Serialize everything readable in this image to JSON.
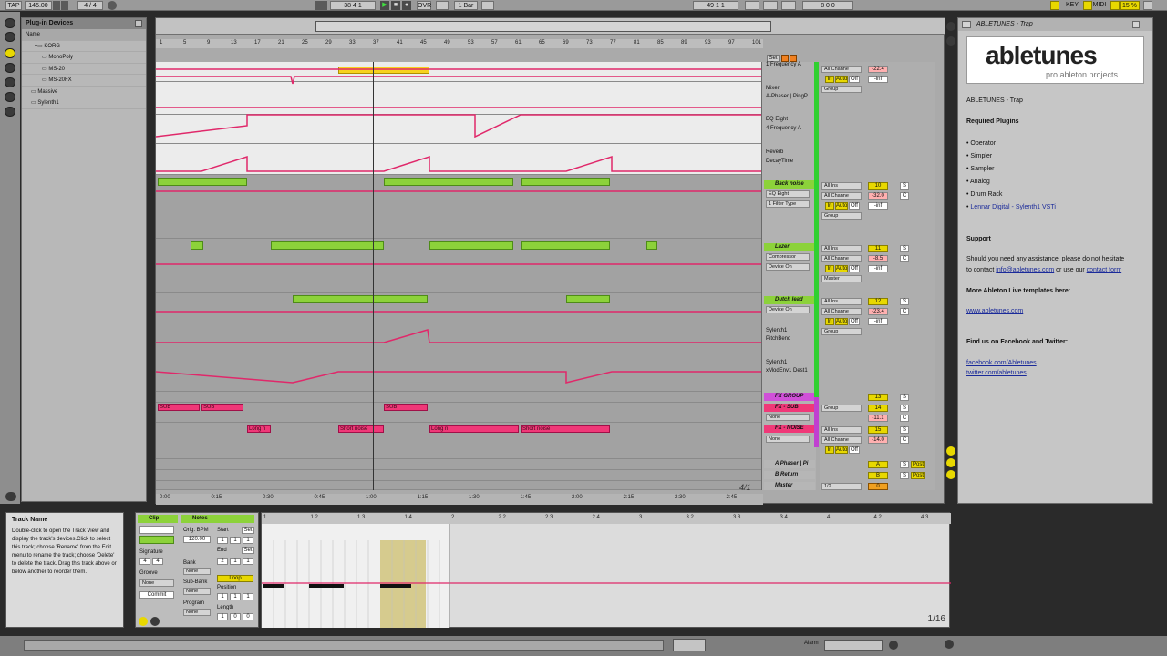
{
  "transport": {
    "tap": "TAP",
    "bpm": "145.00",
    "time_sig": "4 / 4",
    "position": "38   4   1",
    "ovr": "OVR",
    "quantize": "1 Bar",
    "loop_start": "49   1   1",
    "loop_length": "8   0   0",
    "key": "KEY",
    "midi": "MIDI",
    "cpu": "15 %"
  },
  "browser": {
    "header": "Plug-in Devices",
    "col_name": "Name",
    "items": [
      "KORG",
      "MonoPoly",
      "MS-20",
      "MS-20FX",
      "Massive",
      "Sylenth1"
    ]
  },
  "ruler": {
    "bars": [
      "1",
      "5",
      "9",
      "13",
      "17",
      "21",
      "25",
      "29",
      "33",
      "37",
      "41",
      "45",
      "49",
      "53",
      "57",
      "61",
      "65",
      "69",
      "73",
      "77",
      "81",
      "85",
      "89",
      "93",
      "97",
      "101"
    ],
    "set_label": "Set",
    "times": [
      "0:00",
      "0:15",
      "0:30",
      "0:45",
      "1:00",
      "1:15",
      "1:30",
      "1:45",
      "2:00",
      "2:15",
      "2:30",
      "2:45"
    ],
    "zoom": "4/1"
  },
  "tracks": {
    "top_group_auto": [
      "1 Frequency A",
      "Mixer",
      "A-Phaser | PingP",
      "EQ Eight",
      "4 Frequency A",
      "Reverb",
      "DecayTime"
    ],
    "back_noise": {
      "name": "Back noise",
      "device": "EQ Eight",
      "param": "1 Filter Type",
      "num": "10",
      "vol": "-32.0"
    },
    "lazer": {
      "name": "Lazer",
      "device": "Compressor",
      "param": "Device On",
      "num": "11",
      "vol": "-8.5",
      "out": "Master"
    },
    "dutch_lead": {
      "name": "Dutch lead",
      "device": "Device On",
      "num": "12",
      "vol": "-23.4",
      "auto1": "Sylenth1",
      "auto1b": "PitchBend",
      "auto2": "Sylenth1",
      "auto2b": "xModEnv1 Dest1"
    },
    "fx_group": {
      "name": "FX GROUP",
      "num": "13"
    },
    "fx_sub": {
      "name": "FX - SUB",
      "num": "14",
      "vol": "-11.1",
      "sel": "None"
    },
    "fx_noise": {
      "name": "FX - NOISE",
      "num": "15",
      "vol": "-14.0",
      "sel": "None"
    },
    "returns": [
      {
        "name": "A Phaser | Pi",
        "letter": "A",
        "post": "Post"
      },
      {
        "name": "B Return",
        "letter": "B",
        "post": "Post"
      },
      {
        "name": "Master",
        "letter": "0",
        "out": "1/2"
      }
    ]
  },
  "io": {
    "all_ins": "All Ins",
    "all_channels": "All Channe",
    "in": "In",
    "auto": "Auto",
    "off": "Off",
    "group": "Group",
    "inf": "-inf",
    "solo": "S",
    "cue": "C",
    "top_vol": "-22.4"
  },
  "clips": {
    "sub": "SUB",
    "long_noise": "Long n",
    "short_noise": "Short noise"
  },
  "info_panel": {
    "title": "ABLETUNES - Trap",
    "logo_main": "abletunes",
    "logo_sub": "pro ableton projects",
    "heading": "ABLETUNES - Trap",
    "req_label": "Required Plugins",
    "plugins": [
      "Operator",
      "Simpler",
      "Sampler",
      "Analog",
      "Drum Rack",
      "Lennar Digital - Sylenth1 VSTi"
    ],
    "support_label": "Support",
    "support_text1": "Should you need any assistance, please do not hesitate",
    "support_text2a": "to contact ",
    "support_email": "info@abletunes.com",
    "support_text2b": " or use our ",
    "support_form": "contact form",
    "more_label": "More Ableton Live templates here:",
    "more_link": "www.abletunes.com",
    "social_label": "Find us on Facebook and Twitter:",
    "fb": "facebook.com/Abletunes",
    "tw": "twitter.com/abletunes"
  },
  "help": {
    "title": "Track Name",
    "body": "Double-click to open the Track View and display the track's devices.Click to select this track; choose 'Rename' from the Edit menu to rename the track; choose 'Delete' to delete the track. Drag this track above or below another to reorder them."
  },
  "clipview": {
    "clip": "Clip",
    "notes": "Notes",
    "orig_bpm_label": "Orig. BPM",
    "orig_bpm": "120.00",
    "signature": "Signature",
    "sig_n": "4",
    "sig_d": "4",
    "groove": "Groove",
    "none": "None",
    "commit": "Commit",
    "start": "Start",
    "end": "End",
    "loop": "Loop",
    "position": "Position",
    "length": "Length",
    "bank": "Bank",
    "sub_bank": "Sub-Bank",
    "program": "Program",
    "set": "Set",
    "start_vals": [
      "1",
      "1",
      "1"
    ],
    "end_vals": [
      "2",
      "1",
      "1"
    ],
    "pos_vals": [
      "1",
      "1",
      "1"
    ],
    "len_vals": [
      "1",
      "0",
      "0"
    ]
  },
  "notes": {
    "ruler": [
      "1",
      "1.2",
      "1.3",
      "1.4",
      "2",
      "2.2",
      "2.3",
      "2.4",
      "3",
      "3.2",
      "3.3",
      "3.4",
      "4",
      "4.2",
      "4.3"
    ],
    "grid": "1/16"
  },
  "status": {
    "alarm": "Alarm"
  }
}
